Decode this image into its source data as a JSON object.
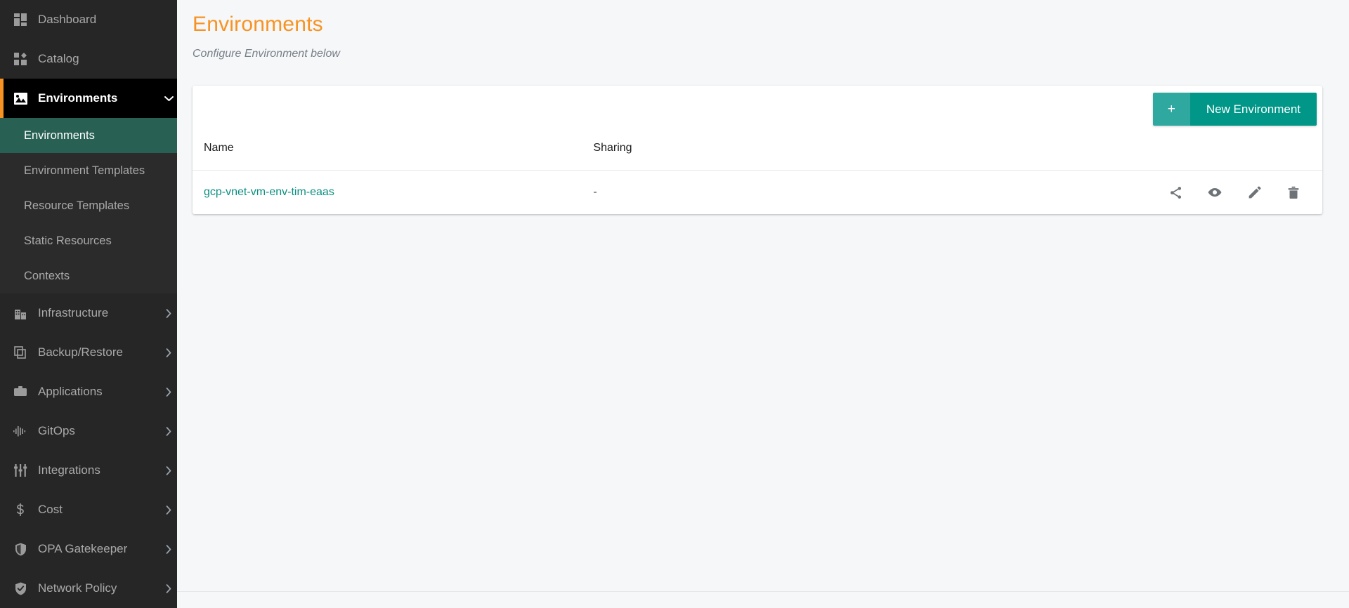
{
  "sidebar": {
    "items": [
      {
        "label": "Dashboard",
        "icon": "dashboard-grid-icon",
        "type": "link"
      },
      {
        "label": "Catalog",
        "icon": "catalog-grid-icon",
        "type": "link"
      },
      {
        "label": "Environments",
        "icon": "environments-image-icon",
        "type": "expandable",
        "expanded": true,
        "caret": "⌄"
      }
    ],
    "sub_items": [
      {
        "label": "Environments",
        "active": true
      },
      {
        "label": "Environment Templates",
        "active": false
      },
      {
        "label": "Resource Templates",
        "active": false
      },
      {
        "label": "Static Resources",
        "active": false
      },
      {
        "label": "Contexts",
        "active": false
      }
    ],
    "lower_items": [
      {
        "label": "Infrastructure",
        "icon": "building-icon",
        "caret": "›"
      },
      {
        "label": "Backup/Restore",
        "icon": "copy-layers-icon",
        "caret": "›"
      },
      {
        "label": "Applications",
        "icon": "briefcase-icon",
        "caret": "›"
      },
      {
        "label": "GitOps",
        "icon": "waveform-icon",
        "caret": "›"
      },
      {
        "label": "Integrations",
        "icon": "sliders-icon",
        "caret": "›"
      },
      {
        "label": "Cost",
        "icon": "dollar-icon",
        "caret": "›"
      },
      {
        "label": "OPA Gatekeeper",
        "icon": "shield-icon",
        "caret": "›"
      },
      {
        "label": "Network Policy",
        "icon": "shield-check-icon",
        "caret": "›"
      }
    ]
  },
  "page": {
    "title": "Environments",
    "subtitle": "Configure Environment below"
  },
  "toolbar": {
    "new_environment_plus": "+",
    "new_environment_label": "New Environment"
  },
  "table": {
    "columns": [
      "Name",
      "Sharing"
    ],
    "rows": [
      {
        "name": "gcp-vnet-vm-env-tim-eaas",
        "sharing": "-",
        "actions": [
          "share-icon",
          "eye-icon",
          "pencil-icon",
          "trash-icon"
        ]
      }
    ]
  },
  "colors": {
    "accent_orange": "#f79322",
    "teal_button": "#009688",
    "teal_button_plus": "#2fa8a0",
    "teal_active_nav": "#286054",
    "link_teal": "#0a8f80",
    "sidebar_bg": "#262626",
    "page_bg": "#f6f7f9"
  }
}
